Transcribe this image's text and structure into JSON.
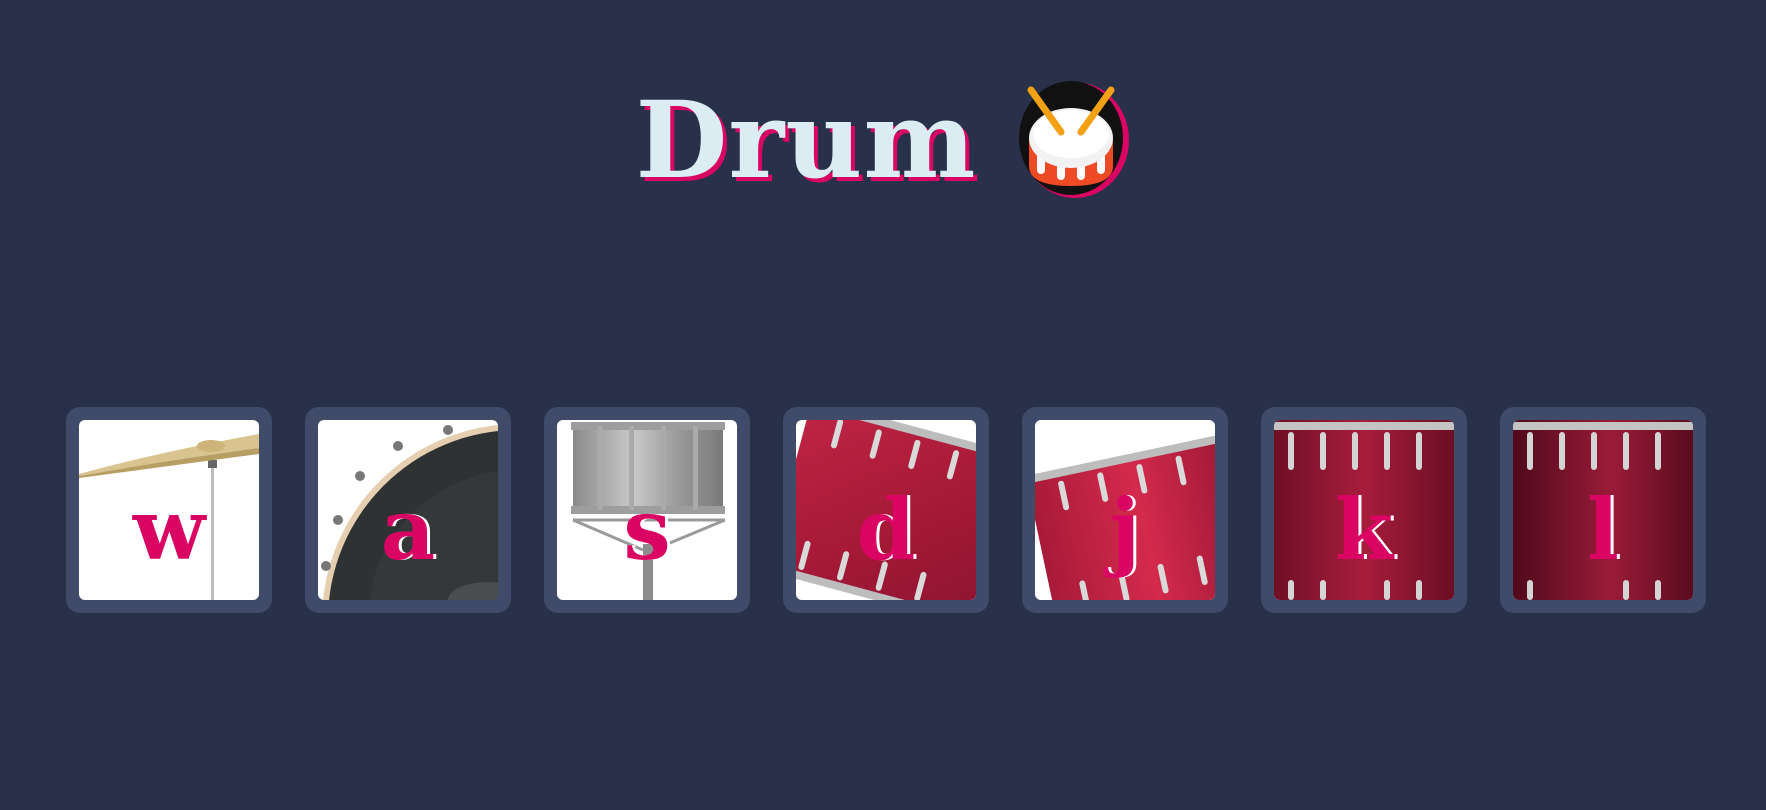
{
  "header": {
    "title": "Drum",
    "icon": "drum-emoji-icon"
  },
  "colors": {
    "background": "#283149",
    "tile": "#404b69",
    "title_text": "#dbedf3",
    "accent": "#da0463"
  },
  "drums": [
    {
      "key": "w",
      "icon": "crash-cymbal-icon"
    },
    {
      "key": "a",
      "icon": "kick-drum-icon"
    },
    {
      "key": "s",
      "icon": "snare-drum-icon"
    },
    {
      "key": "d",
      "icon": "tom-1-icon"
    },
    {
      "key": "j",
      "icon": "tom-2-icon"
    },
    {
      "key": "k",
      "icon": "tom-3-icon"
    },
    {
      "key": "l",
      "icon": "tom-4-icon"
    }
  ]
}
